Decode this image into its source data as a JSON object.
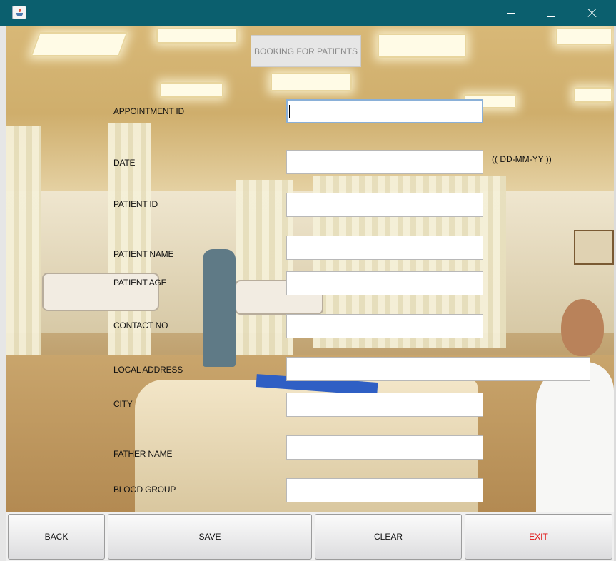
{
  "window": {
    "title": ""
  },
  "heading": {
    "label": "BOOKING FOR PATIENTS"
  },
  "form": {
    "appointment_id": {
      "label": "APPOINTMENT ID",
      "value": ""
    },
    "date": {
      "label": "DATE",
      "value": "",
      "hint": "(( DD-MM-YY ))"
    },
    "patient_id": {
      "label": "PATIENT ID",
      "value": ""
    },
    "patient_name": {
      "label": "PATIENT NAME",
      "value": ""
    },
    "patient_age": {
      "label": "PATIENT AGE",
      "value": ""
    },
    "contact_no": {
      "label": "CONTACT NO",
      "value": ""
    },
    "local_address": {
      "label": "LOCAL ADDRESS",
      "value": ""
    },
    "city": {
      "label": "CITY",
      "value": ""
    },
    "father_name": {
      "label": "FATHER NAME",
      "value": ""
    },
    "blood_group": {
      "label": "BLOOD GROUP",
      "value": ""
    }
  },
  "buttons": {
    "back": "BACK",
    "save": "SAVE",
    "clear": "CLEAR",
    "exit": "EXIT"
  },
  "colors": {
    "titlebar": "#0b5f6e",
    "exit_text": "#e01010",
    "heading_text": "#8a8a8a"
  },
  "icons": {
    "app": "java-cup-icon",
    "minimize": "minimize-icon",
    "maximize": "maximize-icon",
    "close": "close-icon"
  }
}
